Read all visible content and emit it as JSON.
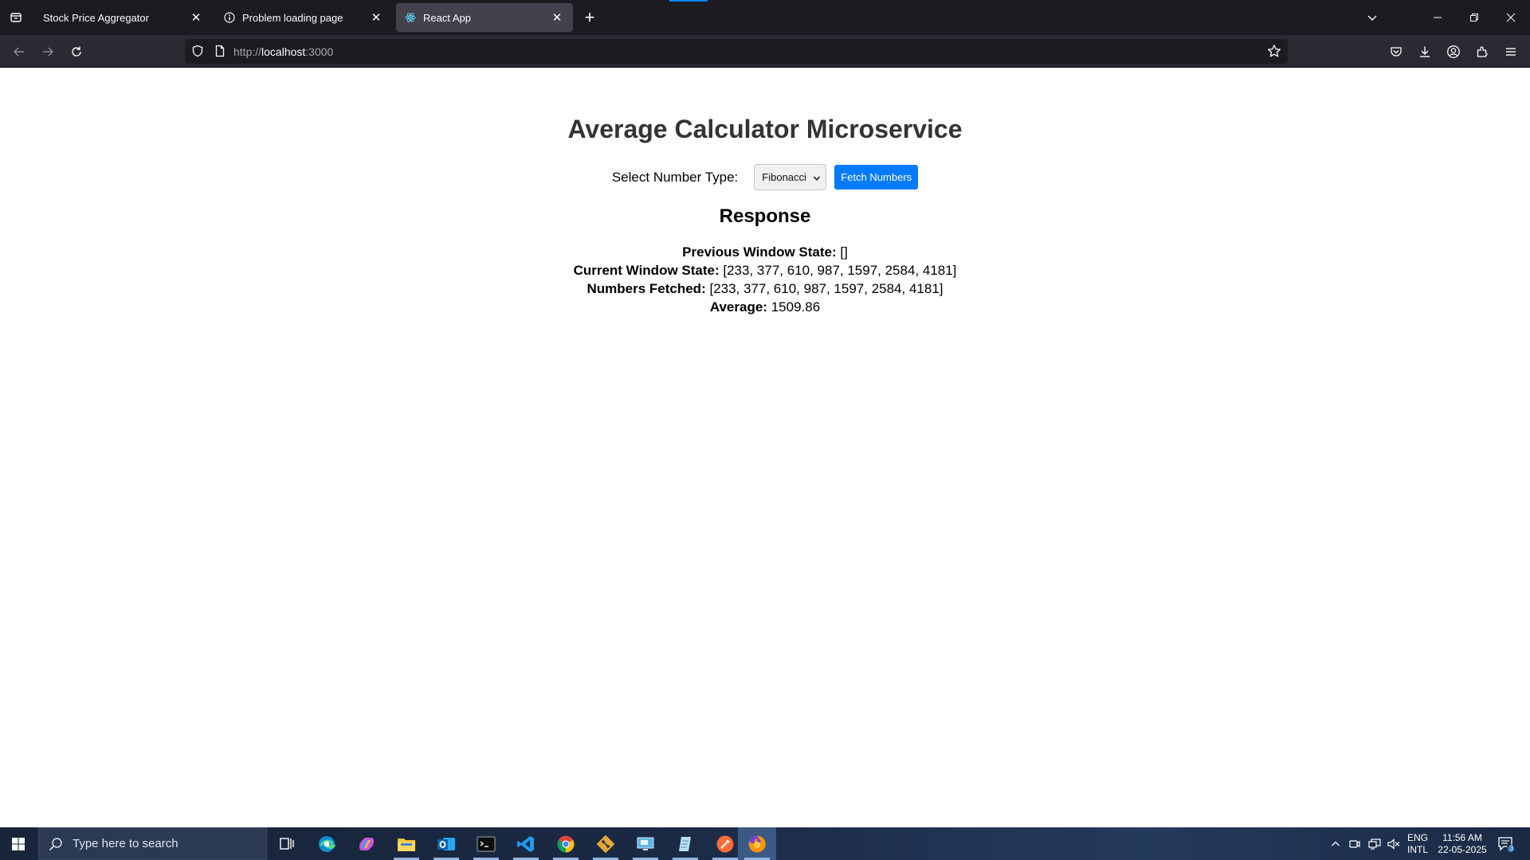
{
  "browser": {
    "tabs": [
      {
        "title": "Stock Price Aggregator",
        "active": false
      },
      {
        "title": "Problem loading page",
        "active": false
      },
      {
        "title": "React App",
        "active": true
      }
    ],
    "url_scheme": "http://",
    "url_host": "localhost",
    "url_rest": ":3000"
  },
  "page": {
    "title": "Average Calculator Microservice",
    "select_label": "Select Number Type:",
    "select_value": "Fibonacci",
    "fetch_button": "Fetch Numbers",
    "response_heading": "Response",
    "previous_label": "Previous Window State:",
    "previous_value": "[]",
    "current_label": "Current Window State:",
    "current_value": "[233, 377, 610, 987, 1597, 2584, 4181]",
    "fetched_label": "Numbers Fetched:",
    "fetched_value": "[233, 377, 610, 987, 1597, 2584, 4181]",
    "average_label": "Average:",
    "average_value": "1509.86"
  },
  "taskbar": {
    "search_placeholder": "Type here to search",
    "apps": [
      "task-view",
      "edge",
      "copilot",
      "file-explorer",
      "outlook",
      "terminal",
      "vscode",
      "chrome",
      "git",
      "remote-desktop",
      "notepad",
      "postman",
      "firefox"
    ],
    "lang_line1": "ENG",
    "lang_line2": "INTL",
    "time": "11:56 AM",
    "date": "22-05-2025",
    "notification_count": "3"
  },
  "colors": {
    "accent": "#007bff",
    "title_color": "#333333",
    "chrome_dark": "#1c1b22",
    "chrome_toolbar": "#2b2a33"
  }
}
